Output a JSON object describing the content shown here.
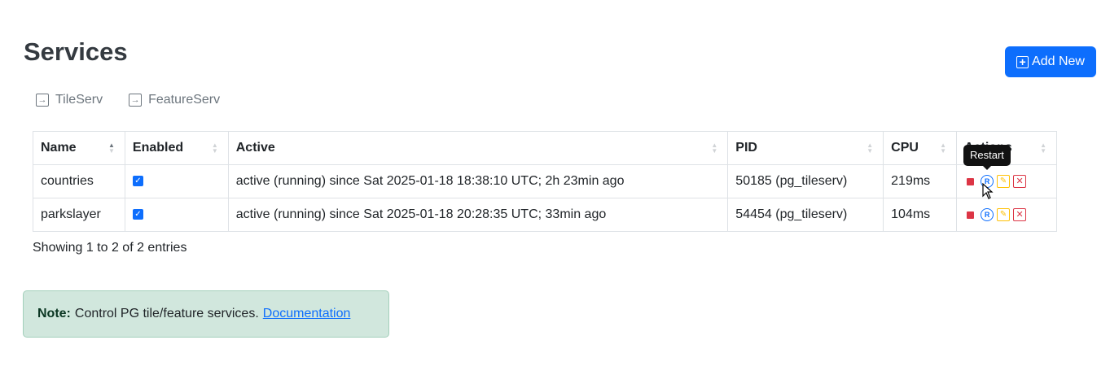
{
  "header": {
    "title": "Services",
    "add_button_label": "Add New",
    "add_icon": "plus-square-icon"
  },
  "service_links": [
    {
      "label": "TileServ",
      "icon": "box-arrow-in-right-icon"
    },
    {
      "label": "FeatureServ",
      "icon": "box-arrow-in-right-icon"
    }
  ],
  "table": {
    "columns": [
      "Name",
      "Enabled",
      "Active",
      "PID",
      "CPU",
      "Actions"
    ],
    "sort": {
      "column": "Name",
      "direction": "ascending"
    },
    "rows": [
      {
        "name": "countries",
        "enabled": true,
        "active": "active (running) since Sat 2025-01-18 18:38:10 UTC; 2h 23min ago",
        "pid": "50185 (pg_tileserv)",
        "cpu": "219ms"
      },
      {
        "name": "parkslayer",
        "enabled": true,
        "active": "active (running) since Sat 2025-01-18 20:28:35 UTC; 33min ago",
        "pid": "54454 (pg_tileserv)",
        "cpu": "104ms"
      }
    ],
    "actions": [
      "stop-icon",
      "restart-icon",
      "edit-icon",
      "delete-icon"
    ],
    "restart_icon_glyph": "R",
    "tooltip": "Restart"
  },
  "entries_info": "Showing 1 to 2 of 2 entries",
  "note": {
    "label": "Note:",
    "text": "Control PG tile/feature services.",
    "link_label": "Documentation"
  },
  "colors": {
    "primary": "#0d6efd",
    "danger": "#dc3545",
    "warning": "#ffc107",
    "note_bg": "#d1e7dd"
  }
}
